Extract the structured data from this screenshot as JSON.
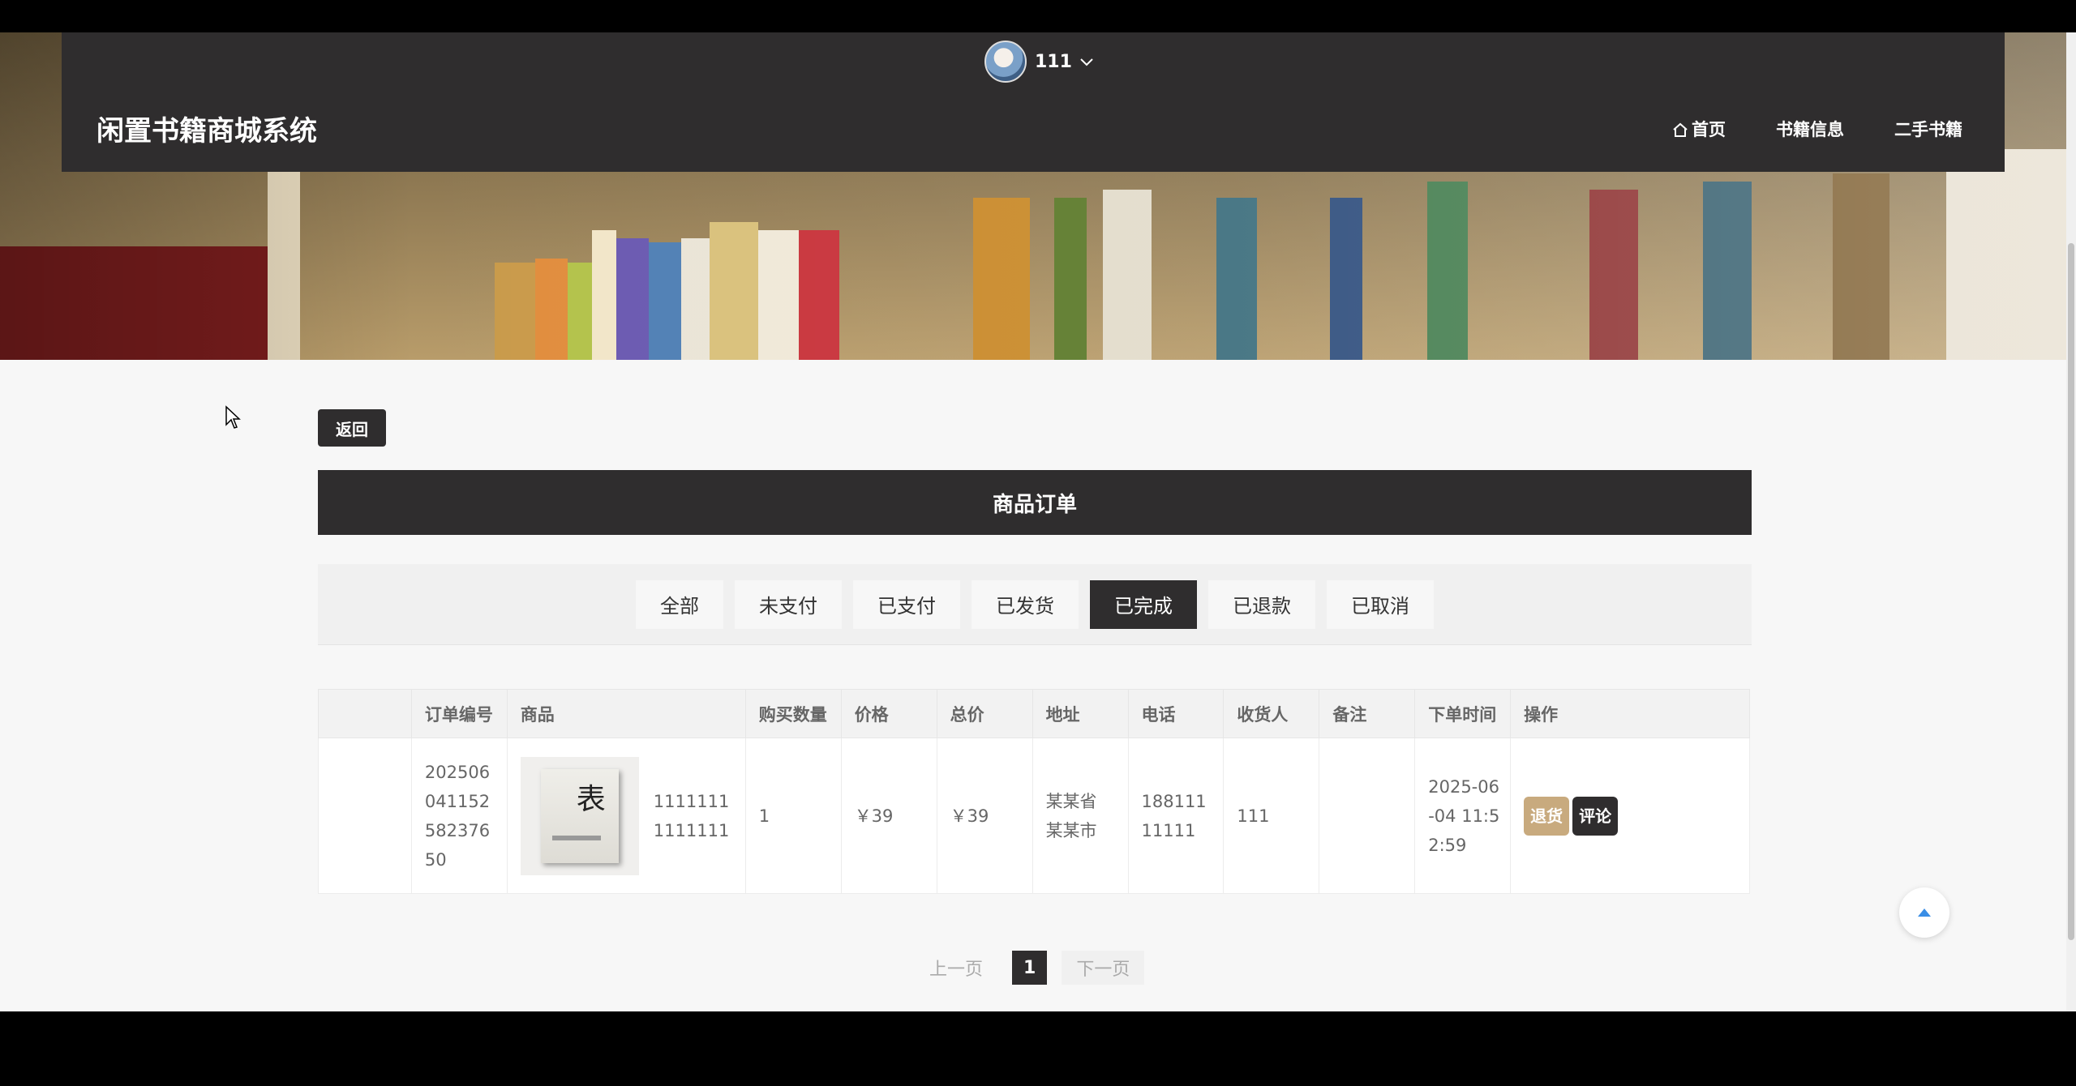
{
  "header": {
    "user_name": "111",
    "site_title": "闲置书籍商城系统",
    "nav": [
      {
        "label": "首页"
      },
      {
        "label": "书籍信息"
      },
      {
        "label": "二手书籍"
      }
    ]
  },
  "content": {
    "back_label": "返回",
    "section_title": "商品订单",
    "tabs": [
      {
        "label": "全部",
        "active": false
      },
      {
        "label": "未支付",
        "active": false
      },
      {
        "label": "已支付",
        "active": false
      },
      {
        "label": "已发货",
        "active": false
      },
      {
        "label": "已完成",
        "active": true
      },
      {
        "label": "已退款",
        "active": false
      },
      {
        "label": "已取消",
        "active": false
      }
    ],
    "table": {
      "headers": [
        "",
        "订单编号",
        "商品",
        "购买数量",
        "价格",
        "总价",
        "地址",
        "电话",
        "收货人",
        "备注",
        "下单时间",
        "操作"
      ],
      "rows": [
        {
          "order_no": "20250604115258237650",
          "goods_name": "11111111111111",
          "qty": "1",
          "price": "￥39",
          "total": "￥39",
          "address": "某某省某某市",
          "phone": "18811111111",
          "receiver": "111",
          "remark": "",
          "time": "2025-06-04 11:52:59",
          "actions": [
            "退货",
            "评论"
          ]
        }
      ]
    },
    "pager": {
      "prev": "上一页",
      "current": "1",
      "next": "下一页"
    }
  },
  "colors": {
    "dark": "#2f2d2e",
    "return_btn": "#c8aa7e",
    "page_bg": "#f7f7f7"
  }
}
